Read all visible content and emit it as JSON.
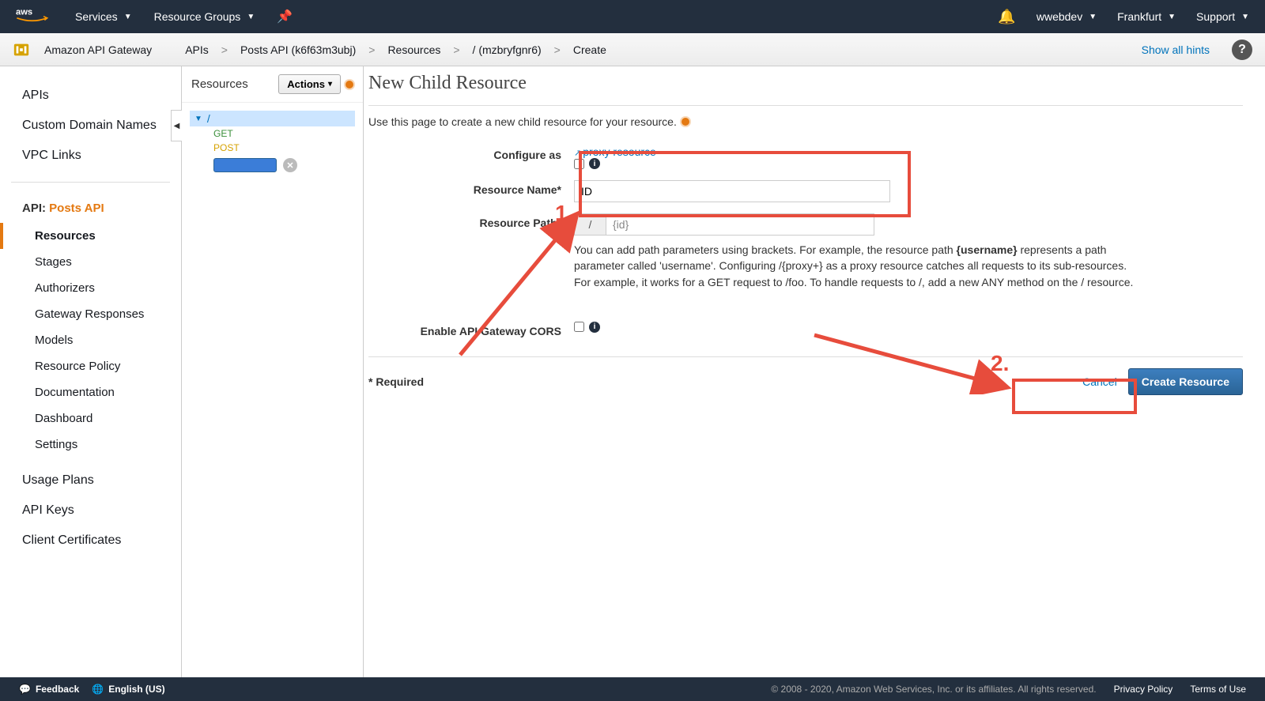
{
  "topnav": {
    "services": "Services",
    "resource_groups": "Resource Groups",
    "user": "wwebdev",
    "region": "Frankfurt",
    "support": "Support"
  },
  "breadcrumb": {
    "service": "Amazon API Gateway",
    "items": [
      "APIs",
      "Posts API (k6f63m3ubj)",
      "Resources",
      "/ (mzbryfgnr6)",
      "Create"
    ],
    "show_hints": "Show all hints"
  },
  "sidebar": {
    "top": [
      "APIs",
      "Custom Domain Names",
      "VPC Links"
    ],
    "api_label_prefix": "API:",
    "api_name": "Posts API",
    "subs": [
      "Resources",
      "Stages",
      "Authorizers",
      "Gateway Responses",
      "Models",
      "Resource Policy",
      "Documentation",
      "Dashboard",
      "Settings"
    ],
    "bottom": [
      "Usage Plans",
      "API Keys",
      "Client Certificates"
    ]
  },
  "tree": {
    "title": "Resources",
    "actions": "Actions",
    "root": "/",
    "methods": [
      "GET",
      "POST"
    ]
  },
  "page": {
    "title": "New Child Resource",
    "desc": "Use this page to create a new child resource for your resource.",
    "configure_as_label": "Configure as",
    "proxy_link": "proxy resource",
    "resource_name_label": "Resource Name*",
    "resource_name_value": "ID",
    "resource_path_label": "Resource Path*",
    "resource_path_prefix": "/",
    "resource_path_value": "{id}",
    "path_help_1": "You can add path parameters using brackets. For example, the resource path ",
    "path_help_bold": "{username}",
    "path_help_2": " represents a path parameter called 'username'. Configuring /{proxy+} as a proxy resource catches all requests to its sub-resources. For example, it works for a GET request to /foo. To handle requests to /, add a new ANY method on the / resource.",
    "cors_label": "Enable API Gateway CORS",
    "required_note": "* Required",
    "cancel": "Cancel",
    "create": "Create Resource",
    "anno1": "1.",
    "anno2": "2."
  },
  "footer": {
    "feedback": "Feedback",
    "language": "English (US)",
    "copyright": "© 2008 - 2020, Amazon Web Services, Inc. or its affiliates. All rights reserved.",
    "privacy": "Privacy Policy",
    "terms": "Terms of Use"
  }
}
